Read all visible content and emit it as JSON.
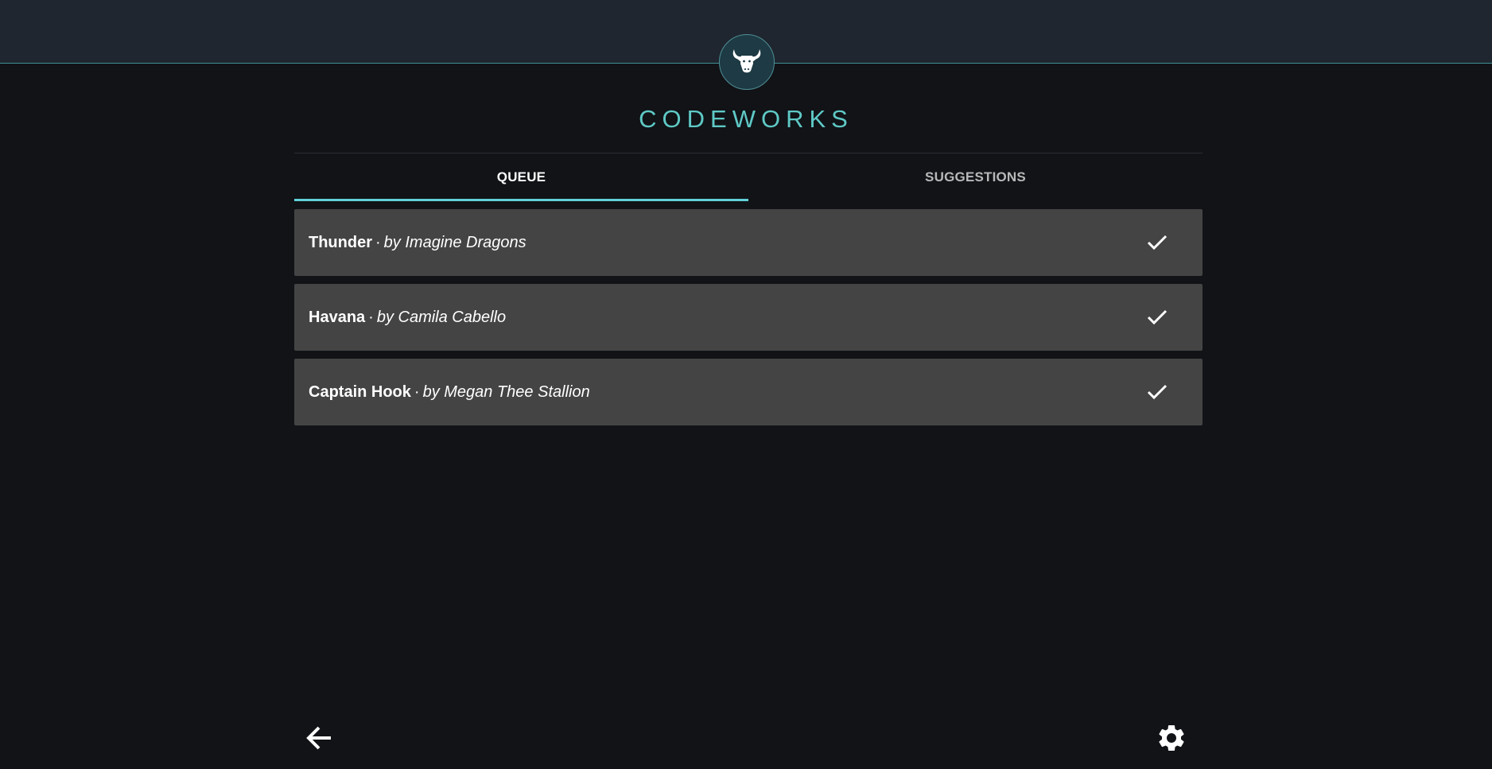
{
  "header": {
    "logo_icon": "bull-icon",
    "brand": "CODEWORKS"
  },
  "tabs": [
    {
      "label": "QUEUE",
      "active": true
    },
    {
      "label": "SUGGESTIONS",
      "active": false
    }
  ],
  "queue": [
    {
      "title": "Thunder",
      "separator": "·",
      "artist": "by Imagine Dragons",
      "action_icon": "check-icon"
    },
    {
      "title": "Havana",
      "separator": "·",
      "artist": "by Camila Cabello",
      "action_icon": "check-icon"
    },
    {
      "title": "Captain Hook",
      "separator": "·",
      "artist": "by Megan Thee Stallion",
      "action_icon": "check-icon"
    }
  ],
  "footer": {
    "back_icon": "arrow-left-icon",
    "settings_icon": "gear-icon"
  },
  "colors": {
    "accent": "#5fc9c6",
    "background": "#111317",
    "topbar": "#1f2630",
    "row": "#444444"
  }
}
